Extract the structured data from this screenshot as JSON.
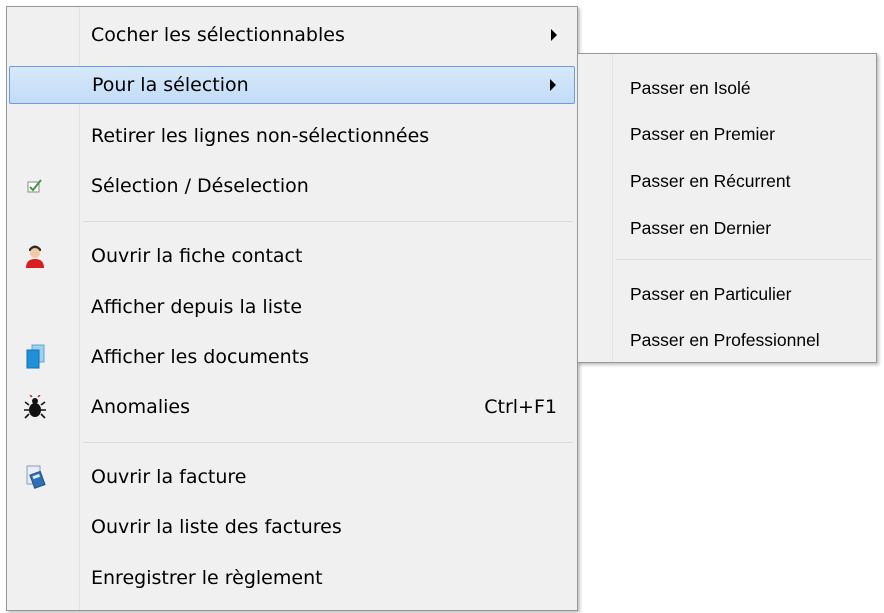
{
  "context_menu": {
    "items": [
      {
        "label": "Cocher les sélectionnables",
        "has_submenu": true
      },
      {
        "label": "Pour la sélection",
        "has_submenu": true,
        "highlighted": true
      },
      {
        "label": "Retirer les lignes non-sélectionnées"
      },
      {
        "label": "Sélection / Déselection",
        "icon": "checkbox-check-icon"
      },
      {
        "label": "Ouvrir la fiche contact",
        "icon": "contact-person-icon"
      },
      {
        "label": "Afficher depuis la liste"
      },
      {
        "label": "Afficher les documents",
        "icon": "documents-icon"
      },
      {
        "label": "Anomalies",
        "icon": "bug-icon",
        "shortcut": "Ctrl+F1"
      },
      {
        "label": "Ouvrir la facture",
        "icon": "invoice-calculator-icon"
      },
      {
        "label": "Ouvrir la liste des factures"
      },
      {
        "label": "Enregistrer le règlement"
      }
    ]
  },
  "submenu": {
    "items": [
      {
        "label": "Passer en Isolé"
      },
      {
        "label": "Passer en Premier"
      },
      {
        "label": "Passer en Récurrent"
      },
      {
        "label": "Passer en Dernier"
      },
      {
        "label": "Passer en Particulier"
      },
      {
        "label": "Passer en Professionnel"
      }
    ]
  },
  "colors": {
    "menu_background": "#f0f0f0",
    "highlight_fill": "#cde3f8",
    "highlight_border": "#6a9ed8"
  }
}
